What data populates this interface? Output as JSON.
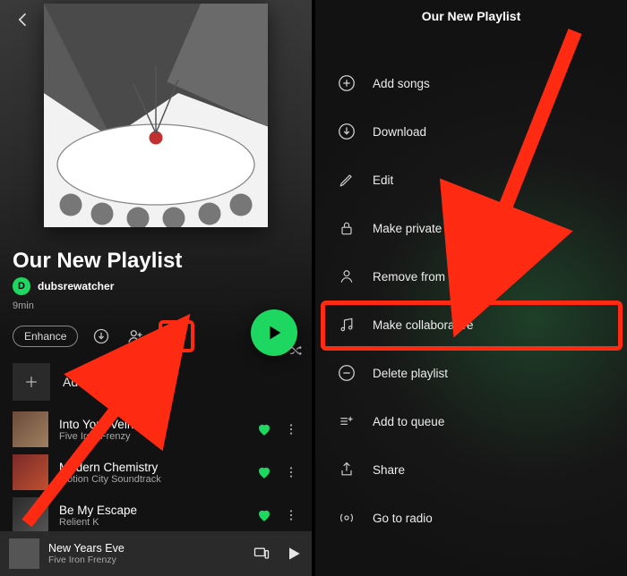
{
  "left": {
    "playlist_title": "Our New Playlist",
    "author_initial": "D",
    "author_name": "dubsrewatcher",
    "duration": "9min",
    "enhance_label": "Enhance",
    "add_songs_label": "Add songs",
    "tracks": [
      {
        "title": "Into Your Veins",
        "artist": "Five Iron Frenzy"
      },
      {
        "title": "Modern Chemistry",
        "artist": "Motion City Soundtrack"
      },
      {
        "title": "Be My Escape",
        "artist": "Relient K"
      }
    ],
    "now_playing": {
      "title": "New Years Eve",
      "artist": "Five Iron Frenzy"
    }
  },
  "right": {
    "title": "Our New Playlist",
    "menu": {
      "add_songs": "Add songs",
      "download": "Download",
      "edit": "Edit",
      "make_private": "Make private",
      "remove_profile": "Remove from profile",
      "make_collaborative": "Make collaborative",
      "delete_playlist": "Delete playlist",
      "add_to_queue": "Add to queue",
      "share": "Share",
      "go_to_radio": "Go to radio"
    }
  },
  "colors": {
    "accent": "#1ed760",
    "highlight": "#ff2a12"
  }
}
